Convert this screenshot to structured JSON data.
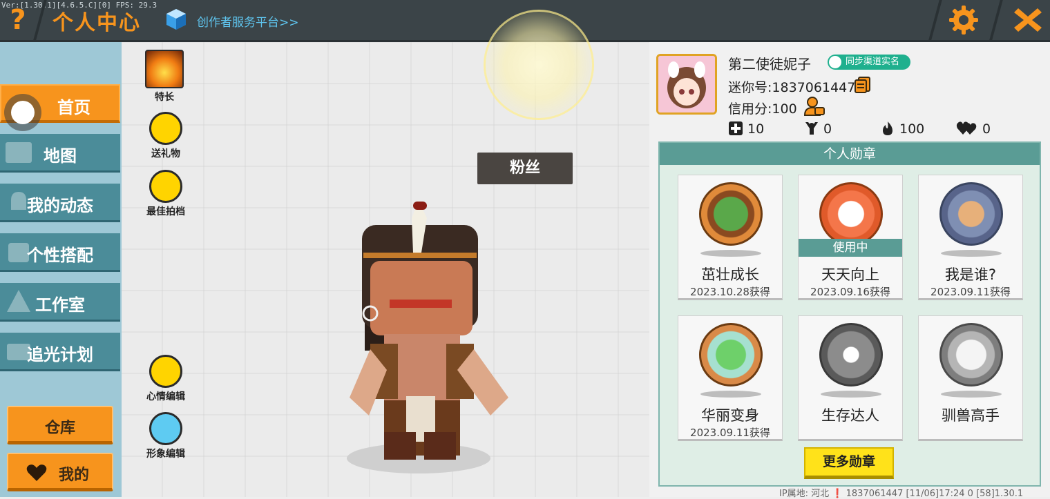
{
  "topbar": {
    "version": "Ver:[1.30.1][4.6.5.C][0] FPS: 29.3",
    "help_icon": "question-mark-icon",
    "title": "个人中心",
    "platform_link": "创作者服务平台>>",
    "accent_color": "#f7941d"
  },
  "sidebar": {
    "items": [
      {
        "label": "首页",
        "icon": "home-icon",
        "active": true
      },
      {
        "label": "地图",
        "icon": "map-icon"
      },
      {
        "label": "我的动态",
        "icon": "bell-icon"
      },
      {
        "label": "个性搭配",
        "icon": "outfit-icon"
      },
      {
        "label": "工作室",
        "icon": "studio-icon"
      },
      {
        "label": "追光计划",
        "icon": "spotlight-icon"
      }
    ],
    "warehouse": "仓库",
    "mine": "我的"
  },
  "actions": {
    "special": "特长",
    "gift": "送礼物",
    "partner": "最佳拍档",
    "mood_edit": "心情编辑",
    "avatar_edit": "形象编辑"
  },
  "fans_label": "粉丝",
  "profile": {
    "name": "第二使徒妮子",
    "realname_badge": "同步渠道实名",
    "uid": "迷你号:1837061447",
    "credit": "信用分:100",
    "stats": {
      "adds": "10",
      "fans": "0",
      "heat": "100",
      "likes": "0"
    }
  },
  "medals": {
    "title": "个人勋章",
    "items": [
      {
        "name": "茁壮成长",
        "date": "2023.10.28获得"
      },
      {
        "name": "天天向上",
        "date": "2023.09.16获得",
        "status": "使用中"
      },
      {
        "name": "我是谁?",
        "date": "2023.09.11获得"
      },
      {
        "name": "华丽变身",
        "date": "2023.09.11获得"
      },
      {
        "name": "生存达人",
        "date": ""
      },
      {
        "name": "驯兽高手",
        "date": ""
      }
    ],
    "more_button": "更多勋章"
  },
  "footer": "IP属地: 河北 ❗ 1837061447 [11/06]17:24 0 [58]1.30.1"
}
